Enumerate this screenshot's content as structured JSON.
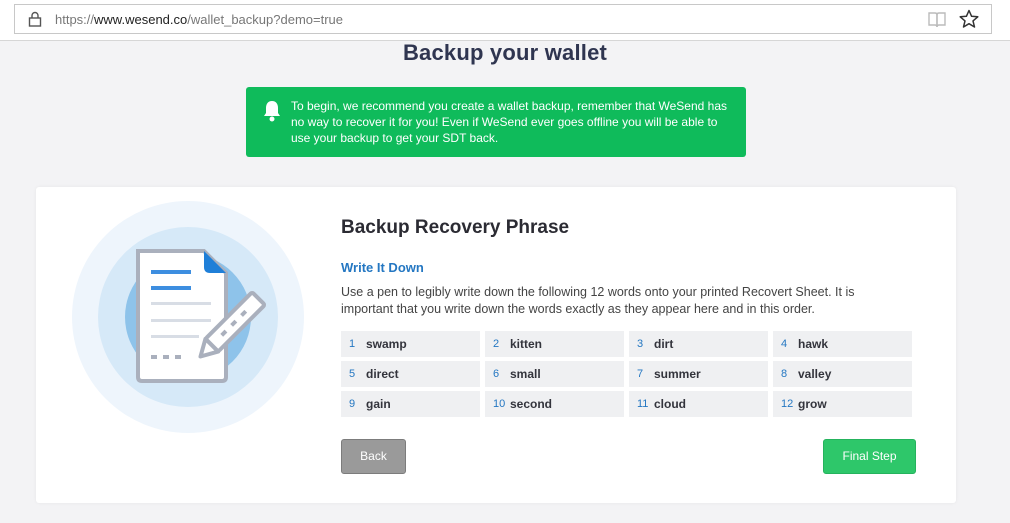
{
  "browser": {
    "url_prefix": "https://",
    "url_host": "www.wesend.co",
    "url_path": "/wallet_backup?demo=true"
  },
  "page": {
    "title": "Backup your wallet"
  },
  "alert": {
    "text": "To begin, we recommend you create a wallet backup, remember that WeSend has no way to recover it for you! Even if WeSend ever goes offline you will be able to use your backup to get your SDT back.",
    "icon": "bell-icon",
    "color": "#0fbb5b"
  },
  "card": {
    "title": "Backup Recovery Phrase",
    "subtitle": "Write It Down",
    "description": "Use a pen to legibly write down the following 12 words onto your printed Recovert Sheet. It is important that you write down the words exactly as they appear here and in this order.",
    "words": [
      {
        "num": "1",
        "word": "swamp"
      },
      {
        "num": "2",
        "word": "kitten"
      },
      {
        "num": "3",
        "word": "dirt"
      },
      {
        "num": "4",
        "word": "hawk"
      },
      {
        "num": "5",
        "word": "direct"
      },
      {
        "num": "6",
        "word": "small"
      },
      {
        "num": "7",
        "word": "summer"
      },
      {
        "num": "8",
        "word": "valley"
      },
      {
        "num": "9",
        "word": "gain"
      },
      {
        "num": "10",
        "word": "second"
      },
      {
        "num": "11",
        "word": "cloud"
      },
      {
        "num": "12",
        "word": "grow"
      }
    ],
    "back_label": "Back",
    "final_label": "Final Step"
  },
  "colors": {
    "accent_blue": "#2477c2",
    "final_button": "#2ec76a",
    "back_button": "#9a9a9a",
    "title": "#2f3550"
  }
}
